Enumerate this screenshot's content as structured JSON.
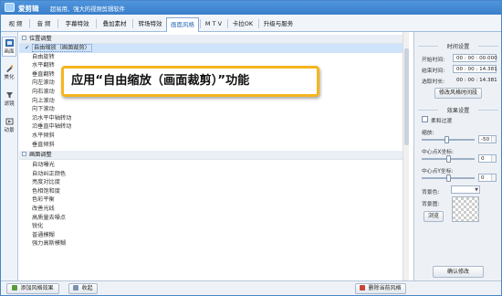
{
  "app": {
    "name": "爱剪辑",
    "slogan": "超易用、强大的视频剪辑软件"
  },
  "tabs": [
    {
      "label": "视  频",
      "active": false
    },
    {
      "label": "音  频",
      "active": false
    },
    {
      "label": "字幕特效",
      "active": false
    },
    {
      "label": "叠加素材",
      "active": false
    },
    {
      "label": "转场特效",
      "active": false
    },
    {
      "label": "画面风格",
      "active": true
    },
    {
      "label": "M T V",
      "active": false
    },
    {
      "label": "卡拉OK",
      "active": false
    },
    {
      "label": "升级与服务",
      "active": false
    }
  ],
  "sidebar": [
    {
      "label": "画面",
      "icon": "picture-icon",
      "active": true
    },
    {
      "label": "美化",
      "icon": "beautify-icon",
      "active": false
    },
    {
      "label": "滤镜",
      "icon": "filter-icon",
      "active": false
    },
    {
      "label": "动景",
      "icon": "motion-icon",
      "active": false
    }
  ],
  "style_list": {
    "category1": "位置调整",
    "items1": [
      "自由缩放（画面裁剪）",
      "自由旋转",
      "水平翻转",
      "垂直翻转",
      "向左滚动",
      "向右滚动",
      "向上滚动",
      "向下滚动",
      "沿水平中轴转动",
      "沿垂直中轴转动",
      "水平倾斜",
      "垂直倾斜"
    ],
    "category2": "画面调整",
    "items2": [
      "自动曝光",
      "自动纠正颜色",
      "亮度对比度",
      "色相饱和度",
      "色彩平衡",
      "改善光线",
      "高质量去噪点",
      "锐化",
      "普通模糊",
      "强力高斯模糊"
    ],
    "selected_index": 0
  },
  "callout": "应用“自由缩放（画面裁剪）”功能",
  "bottom": {
    "add_label": "添加风格效果",
    "collapse_label": "收起",
    "delete_label": "删除当前风格"
  },
  "time_settings": {
    "title": "时间设置",
    "start_label": "开始时间:",
    "start_value": "00 : 00 : 00.000",
    "end_label": "结束时间:",
    "end_value": "00 : 00 : 14.381",
    "duration_label": "选取时长:",
    "duration_value": "00 : 00 : 14.381",
    "modify_button": "修改风格时间段"
  },
  "effect_settings": {
    "title": "效果设置",
    "soft_edge_label": "柔和过渡",
    "zoom_label": "缩放:",
    "zoom_value": "-50",
    "cx_label": "中心点X坐标:",
    "cx_value": "0",
    "cy_label": "中心点Y坐标:",
    "cy_value": "0",
    "bg_color_label": "背景色:",
    "bg_image_label": "背景图:",
    "browse_button": "浏览",
    "confirm_button": "确认修改"
  },
  "colors": {
    "accent": "#3a7fca",
    "callout_border": "#f5b51e",
    "selected_row": "#cfe3fa"
  }
}
